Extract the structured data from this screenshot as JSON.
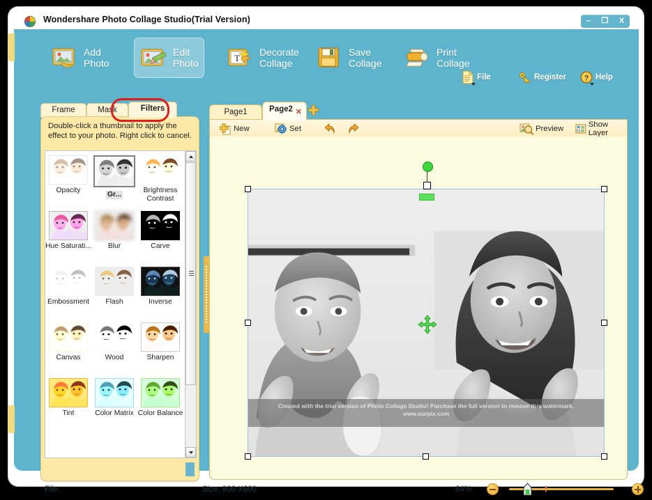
{
  "window": {
    "title": "Wondershare Photo Collage Studio(Trial Version)",
    "app_icon": "wondershare-logo-icon",
    "minimize": "–",
    "maximize": "❐",
    "close": "X"
  },
  "ribbon": {
    "buttons": [
      {
        "id": "add-photo",
        "line1": "Add",
        "line2": "Photo",
        "icon": "photo-add-icon",
        "selected": false
      },
      {
        "id": "edit-photo",
        "line1": "Edit",
        "line2": "Photo",
        "icon": "photo-pencil-icon",
        "selected": true
      },
      {
        "id": "decorate-collage",
        "line1": "Decorate",
        "line2": "Collage",
        "icon": "text-star-icon",
        "selected": false
      },
      {
        "id": "save-collage",
        "line1": "Save",
        "line2": "Collage",
        "icon": "floppy-disk-icon",
        "selected": false
      },
      {
        "id": "print-collage",
        "line1": "Print",
        "line2": "Collage",
        "icon": "printer-icon",
        "selected": false
      }
    ],
    "mini": [
      {
        "id": "file",
        "label": "File",
        "icon": "document-icon",
        "caret": true
      },
      {
        "id": "register",
        "label": "Register",
        "icon": "key-icon",
        "caret": false
      },
      {
        "id": "help",
        "label": "Help",
        "icon": "question-icon",
        "caret": true
      }
    ]
  },
  "left_panel": {
    "tabs": [
      {
        "id": "frame",
        "label": "Frame",
        "active": false,
        "highlighted": false
      },
      {
        "id": "mask",
        "label": "Mask",
        "active": false,
        "highlighted": false
      },
      {
        "id": "filters",
        "label": "Filters",
        "active": true,
        "highlighted": true
      }
    ],
    "hint": "Double-click a thumbnail to apply the effect to your photo. Right click to cancel.",
    "filters": [
      {
        "label": "Opacity",
        "selected": false,
        "style": "opacity"
      },
      {
        "label": "Gr...",
        "selected": true,
        "style": "grayscale"
      },
      {
        "label": "Brightness Contrast",
        "selected": false,
        "style": "bright"
      },
      {
        "label": "Hue Saturati...",
        "selected": false,
        "style": "hue"
      },
      {
        "label": "Blur",
        "selected": false,
        "style": "blur"
      },
      {
        "label": "Carve",
        "selected": false,
        "style": "carve"
      },
      {
        "label": "Embossment",
        "selected": false,
        "style": "emboss"
      },
      {
        "label": "Flash",
        "selected": false,
        "style": "flash"
      },
      {
        "label": "Inverse",
        "selected": false,
        "style": "inverse"
      },
      {
        "label": "Canvas",
        "selected": false,
        "style": "canvas"
      },
      {
        "label": "Wood",
        "selected": false,
        "style": "wood"
      },
      {
        "label": "Sharpen",
        "selected": false,
        "style": "sharpen"
      },
      {
        "label": "Tint",
        "selected": false,
        "style": "tint"
      },
      {
        "label": "Color Matrix",
        "selected": false,
        "style": "cmatrix"
      },
      {
        "label": "Color Balance",
        "selected": false,
        "style": "cbalance"
      }
    ]
  },
  "right_panel": {
    "page_tabs": [
      {
        "id": "page1",
        "label": "Page1",
        "active": false,
        "closable": false
      },
      {
        "id": "page2",
        "label": "Page2",
        "active": true,
        "closable": true,
        "close_glyph": "✕"
      }
    ],
    "add_tab_icon": "plus-icon",
    "toolbar": {
      "left": [
        {
          "id": "new",
          "label": "New",
          "icon": "new-page-icon"
        },
        {
          "id": "set",
          "label": "Set",
          "icon": "settings-gear-icon"
        },
        {
          "id": "undo",
          "label": "",
          "icon": "undo-arrow-icon"
        },
        {
          "id": "redo",
          "label": "",
          "icon": "redo-arrow-icon"
        }
      ],
      "right": [
        {
          "id": "preview",
          "label": "Preview",
          "icon": "preview-magnifier-icon"
        },
        {
          "id": "show-layer",
          "label": "Show Layer",
          "icon": "layers-icon"
        }
      ]
    },
    "watermark": {
      "line1": "Created with the trial version of Photo Collage Studio!  Purchase the full version to remove this watermark.",
      "line2": "www.ourpix.com"
    },
    "selection": {
      "rotate_handle": "rotate-handle",
      "move_cursor": "move-cursor-icon"
    }
  },
  "status_bar": {
    "file_label": "File:",
    "file_value": "",
    "size_label": "Size:",
    "size_value": "800 X600",
    "zoom_value": "64%",
    "zoom_out_icon": "zoom-out-icon",
    "zoom_in_icon": "zoom-in-icon"
  }
}
